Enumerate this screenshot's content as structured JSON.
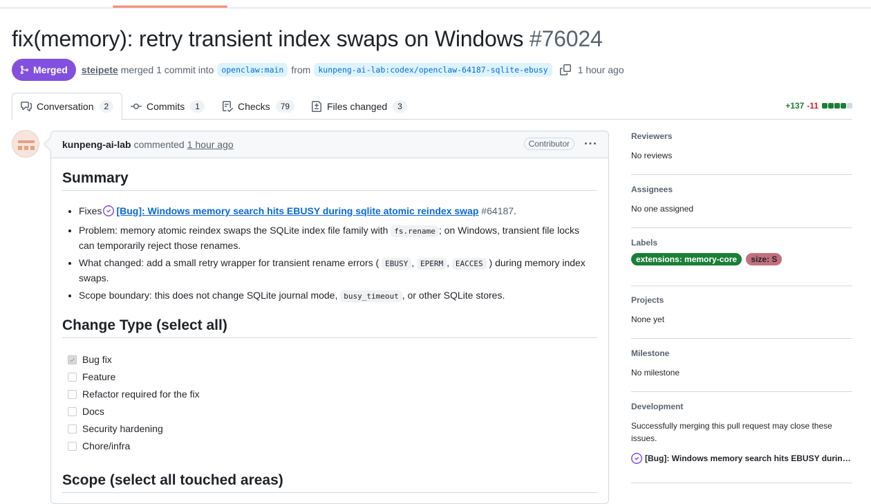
{
  "pr": {
    "title": "fix(memory): retry transient index swaps on Windows",
    "number": "#76024",
    "state": "Merged",
    "author": "steipete",
    "merge_text": "merged 1 commit into",
    "base_branch": "openclaw:main",
    "from_text": "from",
    "head_branch": "kunpeng-ai-lab:codex/openclaw-64187-sqlite-ebusy",
    "time": "1 hour ago"
  },
  "tabs": [
    {
      "label": "Conversation",
      "count": "2"
    },
    {
      "label": "Commits",
      "count": "1"
    },
    {
      "label": "Checks",
      "count": "79"
    },
    {
      "label": "Files changed",
      "count": "3"
    }
  ],
  "diffstat": {
    "additions": "+137",
    "deletions": "-11"
  },
  "comment": {
    "author": "kunpeng-ai-lab",
    "action": "commented",
    "time": "1 hour ago",
    "role": "Contributor",
    "summary_heading": "Summary",
    "summary": {
      "fixes_prefix": "Fixes",
      "issue_title": "[Bug]: Windows memory search hits EBUSY during sqlite atomic reindex swap",
      "issue_ref": "#64187",
      "issue_suffix": ".",
      "problem_a": "Problem: memory atomic reindex swaps the SQLite index file family with",
      "problem_code": "fs.rename",
      "problem_b": "; on Windows, transient file locks can temporarily reject those renames.",
      "changed_a": "What changed: add a small retry wrapper for transient rename errors (",
      "code_ebusy": "EBUSY",
      "code_eperm": "EPERM",
      "code_eacces": "EACCES",
      "comma": ",",
      "changed_b": ") during memory index swaps.",
      "scope_a": "Scope boundary: this does not change SQLite journal mode,",
      "scope_code": "busy_timeout",
      "scope_b": ", or other SQLite stores."
    },
    "change_type_heading": "Change Type (select all)",
    "change_types": [
      {
        "label": "Bug fix",
        "checked": true
      },
      {
        "label": "Feature",
        "checked": false
      },
      {
        "label": "Refactor required for the fix",
        "checked": false
      },
      {
        "label": "Docs",
        "checked": false
      },
      {
        "label": "Security hardening",
        "checked": false
      },
      {
        "label": "Chore/infra",
        "checked": false
      }
    ],
    "scope_heading": "Scope (select all touched areas)"
  },
  "sidebar": {
    "reviewers": {
      "heading": "Reviewers",
      "value": "No reviews"
    },
    "assignees": {
      "heading": "Assignees",
      "value": "No one assigned"
    },
    "labels": {
      "heading": "Labels",
      "items": [
        {
          "name": "extensions: memory-core",
          "color": "#1a7f37",
          "text_color": "#ffffff"
        },
        {
          "name": "size: S",
          "color": "#c46f7d",
          "text_color": "#1f2328"
        }
      ]
    },
    "projects": {
      "heading": "Projects",
      "value": "None yet"
    },
    "milestone": {
      "heading": "Milestone",
      "value": "No milestone"
    },
    "development": {
      "heading": "Development",
      "value": "Successfully merging this pull request may close these issues.",
      "issue": "[Bug]: Windows memory search hits EBUSY during sq..."
    }
  },
  "colors": {
    "merged": "#8250df",
    "link": "#0969da",
    "add": "#1a7f37",
    "del": "#d1242f"
  }
}
